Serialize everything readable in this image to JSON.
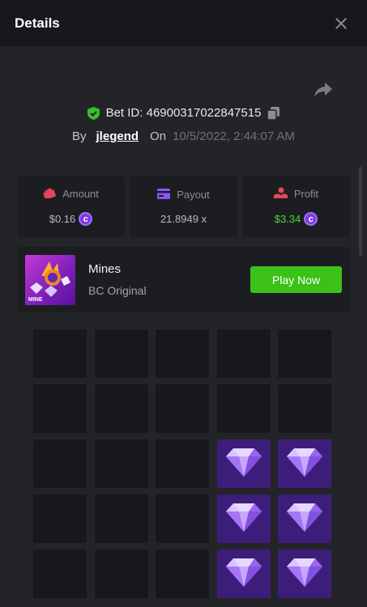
{
  "header": {
    "title": "Details",
    "close_icon": "close-icon"
  },
  "bet": {
    "id_label": "Bet ID: 46900317022847515",
    "by_label": "By",
    "username": "jlegend",
    "on_label": "On",
    "datetime": "10/5/2022, 2:44:07 AM"
  },
  "stats": {
    "amount": {
      "label": "Amount",
      "value": "$0.16",
      "icon": "wallet-icon"
    },
    "payout": {
      "label": "Payout",
      "value": "21.8949 x",
      "icon": "card-icon"
    },
    "profit": {
      "label": "Profit",
      "value": "$3.34",
      "icon": "profit-icon"
    }
  },
  "game": {
    "name": "Mines",
    "subtitle": "BC Original",
    "thumb_label": "MINE",
    "play_label": "Play Now"
  },
  "board": {
    "rows": 5,
    "cols": 5,
    "revealed_gems": [
      [
        2,
        3
      ],
      [
        2,
        4
      ],
      [
        3,
        3
      ],
      [
        3,
        4
      ],
      [
        4,
        3
      ],
      [
        4,
        4
      ]
    ]
  },
  "colors": {
    "accent_green": "#3bc117",
    "gem_tile": "#3d1d7a",
    "coin": "#7c3be0"
  }
}
